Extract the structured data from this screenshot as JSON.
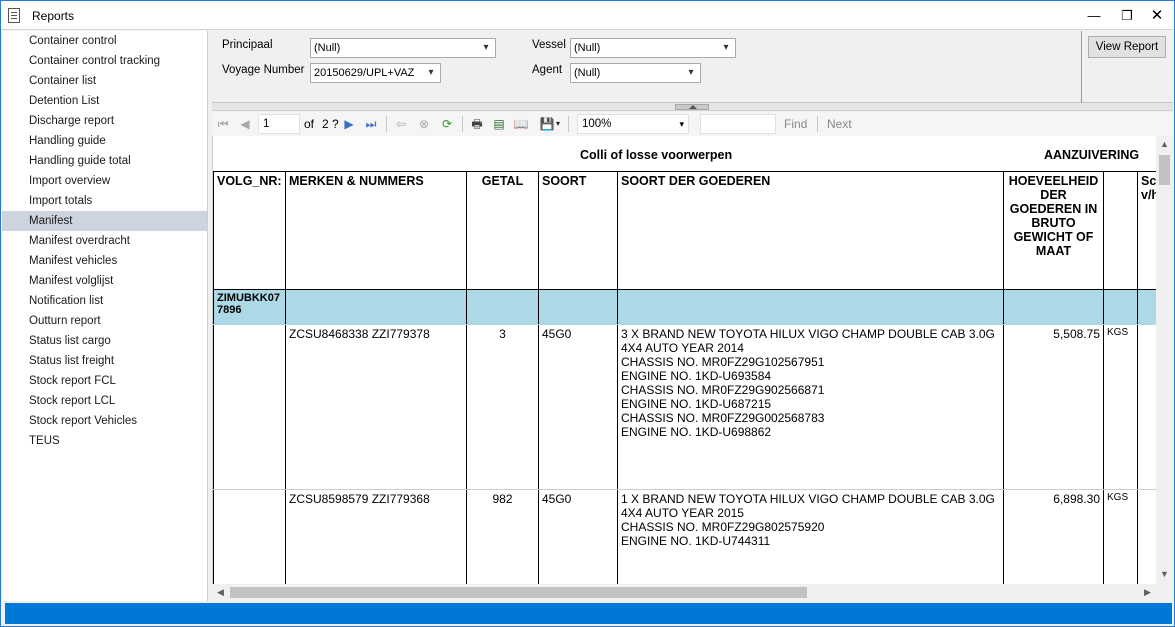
{
  "window": {
    "title": "Reports",
    "minimize": "—",
    "maximize": "❐",
    "close": "✕"
  },
  "sidebar": {
    "items": [
      "Container control",
      "Container control tracking",
      "Container list",
      "Detention List",
      "Discharge report",
      "Handling guide",
      "Handling guide total",
      "Import overview",
      "Import totals",
      "Manifest",
      "Manifest overdracht",
      "Manifest vehicles",
      "Manifest volglijst",
      "Notification list",
      "Outturn report",
      "Status list cargo",
      "Status list freight",
      "Stock report FCL",
      "Stock report LCL",
      "Stock report Vehicles",
      "TEUS"
    ],
    "selected": "Manifest"
  },
  "params": {
    "principaal_label": "Principaal",
    "principaal_value": "(Null)",
    "voyage_label": "Voyage Number",
    "voyage_value": "20150629/UPL+VAZ",
    "vessel_label": "Vessel",
    "vessel_value": "(Null)",
    "agent_label": "Agent",
    "agent_value": "(Null)",
    "view_report": "View Report"
  },
  "toolbar": {
    "page": "1",
    "of_label": "of",
    "page_total": "2 ?",
    "zoom": "100%",
    "find": "Find",
    "next": "Next",
    "icons": {
      "first": "⏮",
      "prev": "◀",
      "next": "▶",
      "last": "⏭",
      "back": "⇦",
      "stop": "⊗",
      "refresh": "⟳",
      "print": "🖶",
      "layout": "▤",
      "page_setup": "📖",
      "export": "💾"
    }
  },
  "report": {
    "title": "Colli of losse voorwerpen",
    "right_title": "AANZUIVERING",
    "headers": [
      "VOLG_NR:",
      "MERKEN & NUMMERS",
      "GETAL",
      "SOORT",
      "SOORT DER GOEDEREN",
      "HOEVEELHEID DER GOEDEREN IN BRUTO GEWICHT OF MAAT",
      "",
      "Sc v/h"
    ],
    "group": "ZIMUBKK077896",
    "rows": [
      {
        "marks": "ZCSU8468338 ZZI779378",
        "count": "3",
        "type": "45G0",
        "goods": "3 X BRAND NEW TOYOTA HILUX VIGO CHAMP DOUBLE CAB 3.0G\n4X4 AUTO YEAR 2014\nCHASSIS NO. MR0FZ29G102567951\nENGINE NO. 1KD-U693584\nCHASSIS NO. MR0FZ29G902566871\nENGINE NO. 1KD-U687215\nCHASSIS NO. MR0FZ29G002568783\nENGINE NO. 1KD-U698862",
        "weight": "5,508.75",
        "unit": "KGS"
      },
      {
        "marks": "ZCSU8598579 ZZI779368",
        "count": "982",
        "type": "45G0",
        "goods": "1 X BRAND NEW TOYOTA HILUX VIGO CHAMP DOUBLE CAB 3.0G\n4X4 AUTO YEAR 2015\nCHASSIS NO. MR0FZ29G802575920\nENGINE NO. 1KD-U744311",
        "weight": "6,898.30",
        "unit": "KGS"
      }
    ]
  },
  "scroll": {
    "up": "▲",
    "down": "▼",
    "left": "◀",
    "right": "▶"
  }
}
